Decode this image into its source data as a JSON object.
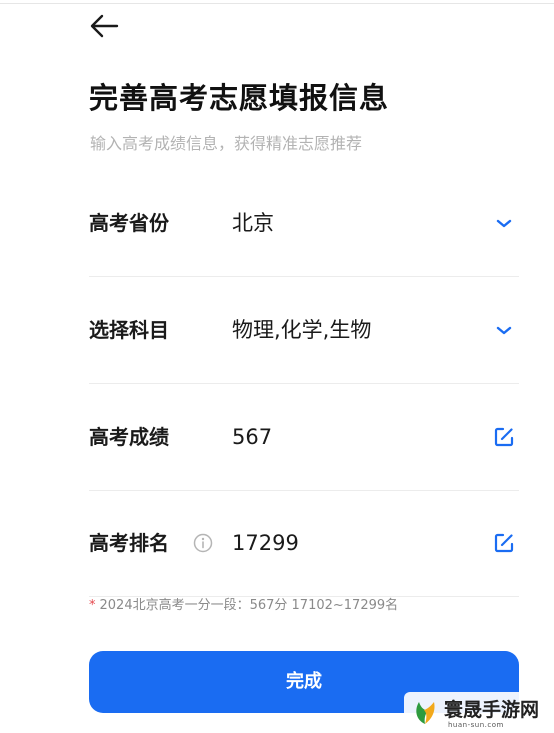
{
  "header": {
    "back_icon": "arrow-left-icon",
    "title": "完善高考志愿填报信息",
    "subtitle": "输入高考成绩信息，获得精准志愿推荐"
  },
  "form": {
    "rows": [
      {
        "label": "高考省份",
        "value": "北京",
        "icon": "chevron-down-icon"
      },
      {
        "label": "选择科目",
        "value": "物理,化学,生物",
        "icon": "chevron-down-icon"
      },
      {
        "label": "高考成绩",
        "value": "567",
        "icon": "edit-icon"
      },
      {
        "label": "高考排名",
        "value": "17299",
        "icon": "edit-icon",
        "info_icon": "info-icon"
      }
    ]
  },
  "note": {
    "mark": "*",
    "text": "2024北京高考一分一段：567分 17102~17299名"
  },
  "submit": {
    "label": "完成"
  },
  "watermark": {
    "name": "寰晟手游网",
    "url": "huan-sun.com"
  },
  "colors": {
    "accent": "#1a6cf2",
    "note_mark": "#e5484d",
    "subtitle": "#b3b3b3",
    "divider": "#ececec"
  }
}
